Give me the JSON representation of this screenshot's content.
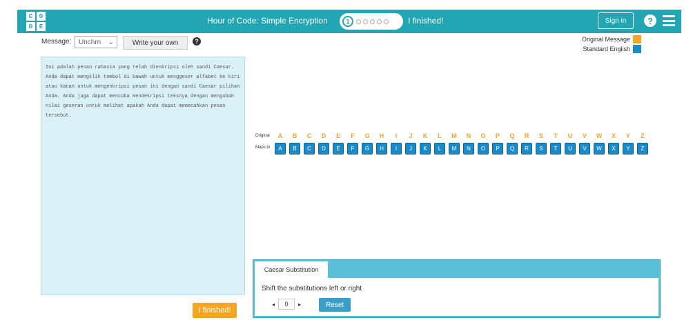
{
  "header": {
    "logo_letters": [
      "C",
      "O",
      "D",
      "E"
    ],
    "title": "Hour of Code: Simple Encryption",
    "progress_current": "1",
    "progress_total_dots": 5,
    "finished_label": "I finished!",
    "signin_label": "Sign in",
    "help_glyph": "?",
    "accent_color": "#22a6b3"
  },
  "message_bar": {
    "label": "Message:",
    "selected": "Unchrn",
    "write_own_label": "Write your own",
    "help_glyph": "?"
  },
  "message_text": "Ini adalah pesan rahasia yang telah dienkripsi oleh sandi Caesar. Anda dapat mengklik tombol di bawah untuk menggeser alfabet ke kiri atau kanan untuk mengenkripsi pesan ini dengan sandi Caesar pilihan Anda. Anda juga dapat mencoba mendekripsi teksnya dengan mengubah nilai geseran untuk melihat apakah Anda dapat memecahkan pesan tersebut.",
  "finished_button": "I finished!",
  "legend": {
    "original": "Original Message",
    "original_color": "#f5a623",
    "standard": "Standard English",
    "standard_color": "#1b8bc8"
  },
  "cipher": {
    "row1_label": "Original",
    "row2_label": "Maps to",
    "letters": [
      "A",
      "B",
      "C",
      "D",
      "E",
      "F",
      "G",
      "H",
      "I",
      "J",
      "K",
      "L",
      "M",
      "N",
      "O",
      "P",
      "Q",
      "R",
      "S",
      "T",
      "U",
      "V",
      "W",
      "X",
      "Y",
      "Z"
    ],
    "mapped": [
      "A",
      "B",
      "C",
      "D",
      "E",
      "F",
      "G",
      "H",
      "I",
      "J",
      "K",
      "L",
      "M",
      "N",
      "O",
      "P",
      "Q",
      "R",
      "S",
      "T",
      "U",
      "V",
      "W",
      "X",
      "Y",
      "Z"
    ]
  },
  "panel": {
    "tab_label": "Caesar Substitution",
    "instruction": "Shift the substitutions left or right",
    "shift_value": "0",
    "left_arrow": "◂",
    "right_arrow": "▸",
    "reset_label": "Reset"
  }
}
